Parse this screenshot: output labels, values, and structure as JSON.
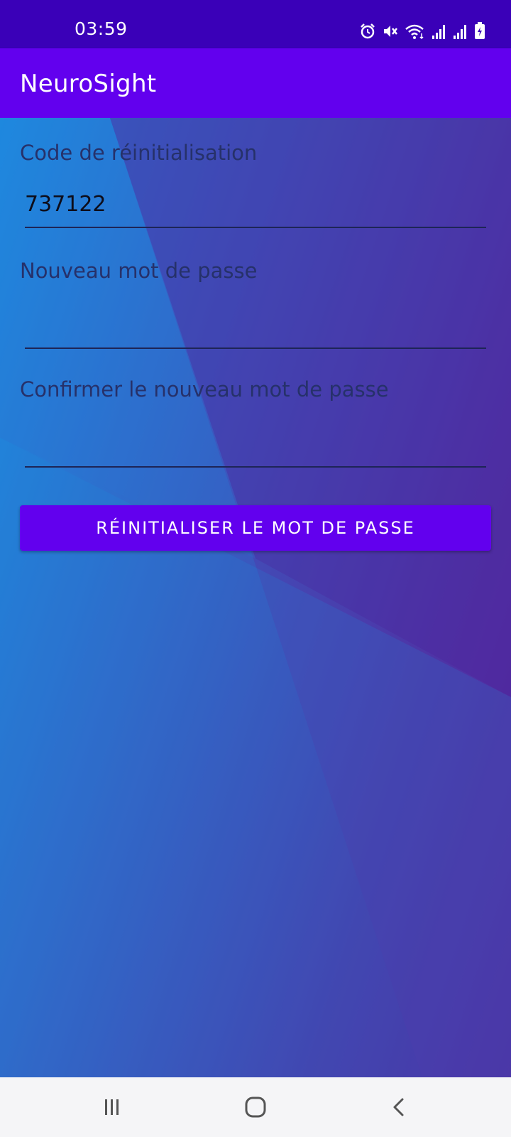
{
  "status_bar": {
    "time": "03:59",
    "icons": [
      "alarm-icon",
      "mute-icon",
      "wifi-icon",
      "signal-icon",
      "signal-icon",
      "battery-charging-icon"
    ]
  },
  "app_bar": {
    "title": "NeuroSight"
  },
  "form": {
    "reset_code_label": "Code de réinitialisation",
    "reset_code_value": "737122",
    "new_password_label": "Nouveau mot de passe",
    "new_password_value": "",
    "confirm_password_label": "Confirmer le nouveau mot de passe",
    "confirm_password_value": "",
    "submit_label": "RÉINITIALISER LE MOT DE PASSE"
  },
  "nav_bar": {
    "buttons": [
      "recent-apps-icon",
      "home-icon",
      "back-icon"
    ]
  },
  "colors": {
    "status_bar": "#3a00b8",
    "app_bar": "#6200ee",
    "button": "#6200ee",
    "label_text": "#26316a",
    "nav_bar": "#f5f5f7"
  }
}
